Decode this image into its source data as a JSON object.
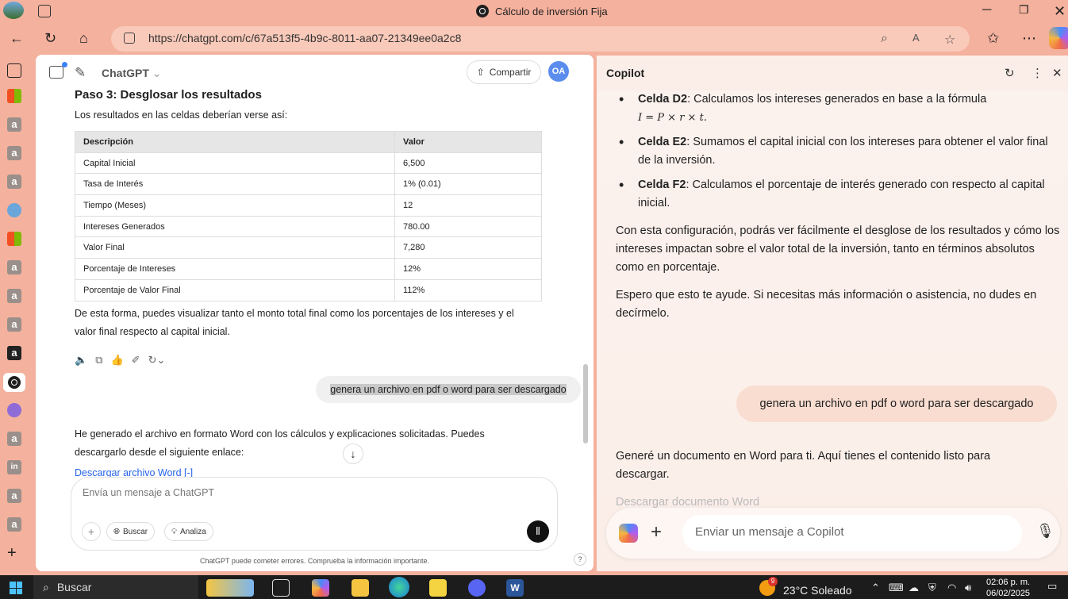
{
  "window": {
    "title": "Cálculo de inversión Fija",
    "url": "https://chatgpt.com/c/67a513f5-4b9c-8011-aa07-21349ee0a2c8"
  },
  "chatgpt": {
    "model": "ChatGPT",
    "share_label": "Compartir",
    "avatar": "OA",
    "step_title": "Paso 3: Desglosar los resultados",
    "intro": "Los resultados en las celdas deberían verse así:",
    "table": {
      "headers": [
        "Descripción",
        "Valor"
      ],
      "rows": [
        [
          "Capital Inicial",
          "6,500"
        ],
        [
          "Tasa de Interés",
          "1% (0.01)"
        ],
        [
          "Tiempo (Meses)",
          "12"
        ],
        [
          "Intereses Generados",
          "780.00"
        ],
        [
          "Valor Final",
          "7,280"
        ],
        [
          "Porcentaje de Intereses",
          "12%"
        ],
        [
          "Porcentaje de Valor Final",
          "112%"
        ]
      ]
    },
    "summary": "De esta forma, puedes visualizar tanto el monto total final como los porcentajes de los intereses y el valor final respecto al capital inicial.",
    "user_message": "genera un archivo en pdf o word para ser descargado",
    "reply": "He generado el archivo en formato Word con los cálculos y explicaciones solicitadas. Puedes descargarlo desde el siguiente enlace:",
    "link": "Descargar archivo Word [-]",
    "composer_placeholder": "Envía un mensaje a ChatGPT",
    "chip_search": "Buscar",
    "chip_analyze": "Analiza",
    "disclaimer": "ChatGPT puede cometer errores. Comprueba la información importante.",
    "help": "?"
  },
  "copilot": {
    "title": "Copilot",
    "bullets": [
      {
        "bold": "Celda D2",
        "text": ": Calculamos los intereses generados en base a la fórmula",
        "formula": "I = P × r × t."
      },
      {
        "bold": "Celda E2",
        "text": ": Sumamos el capital inicial con los intereses para obtener el valor final de la inversión."
      },
      {
        "bold": "Celda F2",
        "text": ": Calculamos el porcentaje de interés generado con respecto al capital inicial."
      }
    ],
    "para1": "Con esta configuración, podrás ver fácilmente el desglose de los resultados y cómo los intereses impactan sobre el valor total de la inversión, tanto en términos absolutos como en porcentaje.",
    "para2": "Espero que esto te ayude. Si necesitas más información o asistencia, no dudes en decírmelo.",
    "user_message": "genera un archivo en pdf o word para ser descargado",
    "reply": "Generé un documento en Word para ti. Aquí tienes el contenido listo para descargar.",
    "faded_link": "Descargar documento Word",
    "composer_placeholder": "Enviar un mensaje a Copilot"
  },
  "taskbar": {
    "search": "Buscar",
    "weather": "23°C  Soleado",
    "weather_badge": "9",
    "time": "02:06 p. m.",
    "date": "06/02/2025"
  }
}
